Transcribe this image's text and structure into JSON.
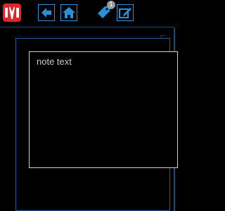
{
  "toolbar": {
    "app_logo": "app-logo-icon",
    "buttons": [
      {
        "name": "back",
        "icon": "arrow-left-icon"
      },
      {
        "name": "home",
        "icon": "home-icon"
      },
      {
        "name": "tag",
        "icon": "tag-icon"
      },
      {
        "name": "edit",
        "icon": "edit-icon"
      }
    ],
    "tag_badge": "1"
  },
  "note": {
    "placeholder": "note text"
  },
  "colors": {
    "accent": "#2a8fd9",
    "logo": "#e0242b",
    "background": "#000000",
    "text": "#c8c8c8"
  }
}
